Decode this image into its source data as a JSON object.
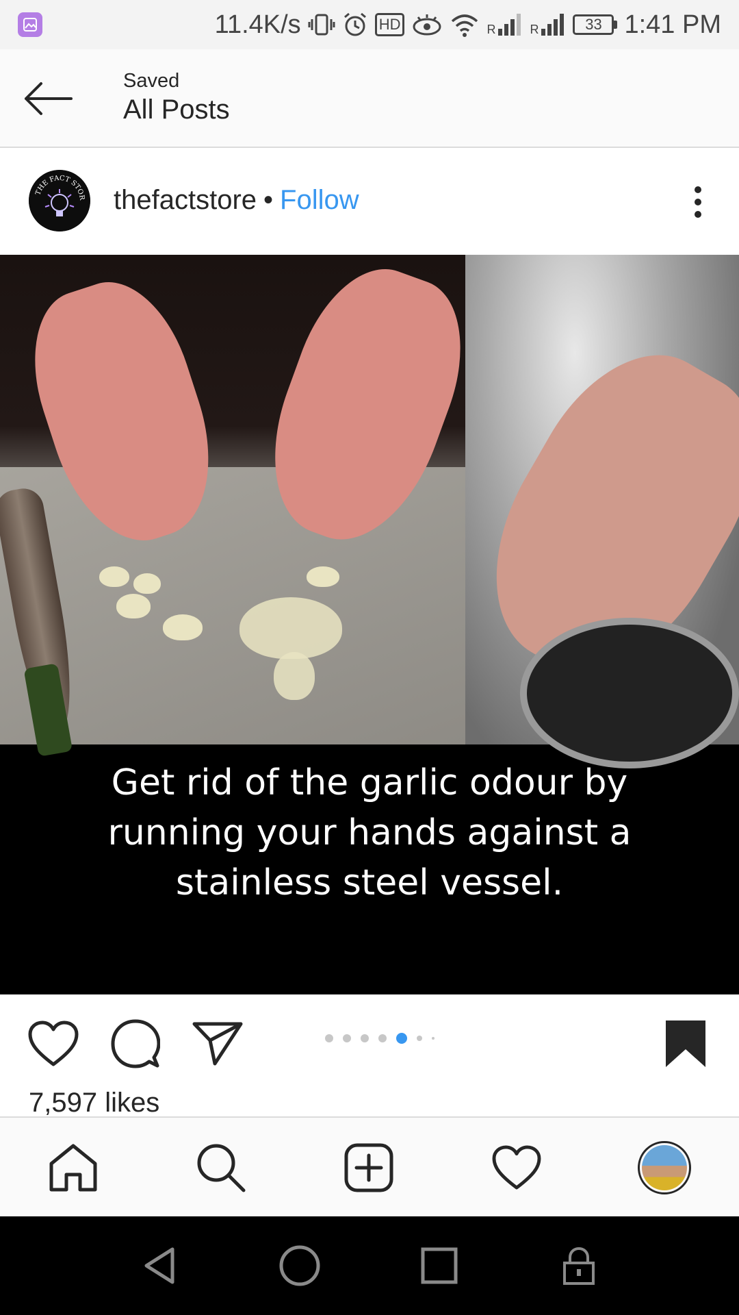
{
  "status_bar": {
    "net_speed": "11.4K/s",
    "hd_badge": "HD",
    "signal1_label": "R",
    "signal2_label": "R",
    "battery": "33",
    "time": "1:41 PM"
  },
  "header": {
    "subtitle": "Saved",
    "title": "All Posts"
  },
  "post": {
    "username": "thefactstore",
    "separator": "•",
    "follow_label": "Follow",
    "avatar_text": "THE FACT STORE",
    "caption_lines": [
      "Get rid of the garlic odour by",
      "running your hands against a",
      "stainless steel vessel."
    ],
    "likes": "7,597 likes",
    "carousel": {
      "total": 7,
      "active_index": 4
    },
    "bookmarked": true
  },
  "colors": {
    "accent": "#3897f0",
    "text": "#262626",
    "header_bg": "#fafafa",
    "status_bg": "#f3f3f3"
  },
  "icons": {
    "action_bar": [
      "heart-icon",
      "comment-icon",
      "share-icon",
      "bookmark-icon"
    ],
    "bottom_nav": [
      "home-icon",
      "search-icon",
      "add-icon",
      "activity-heart-icon",
      "profile-avatar"
    ],
    "system_nav": [
      "back-triangle-icon",
      "home-circle-icon",
      "recents-square-icon",
      "lock-icon"
    ]
  }
}
